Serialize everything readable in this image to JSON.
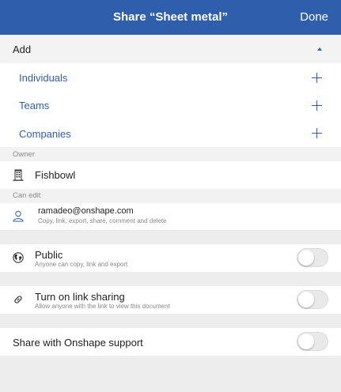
{
  "header": {
    "title": "Share “Sheet metal”",
    "done_label": "Done"
  },
  "add_section": {
    "label": "Add",
    "items": [
      {
        "label": "Individuals"
      },
      {
        "label": "Teams"
      },
      {
        "label": "Companies"
      }
    ]
  },
  "owner": {
    "section_label": "Owner",
    "name": "Fishbowl"
  },
  "can_edit": {
    "section_label": "Can edit",
    "user": "ramadeo@onshape.com",
    "permissions": "Copy, link, export, share, comment and delete"
  },
  "public": {
    "label": "Public",
    "description": "Anyone can copy, link and export",
    "enabled": false
  },
  "link_sharing": {
    "label": "Turn on link sharing",
    "description": "Allow anyone with the link to view this document",
    "enabled": false
  },
  "support": {
    "label": "Share with Onshape support",
    "enabled": false
  },
  "colors": {
    "accent": "#2f5eac",
    "background": "#ededed"
  }
}
